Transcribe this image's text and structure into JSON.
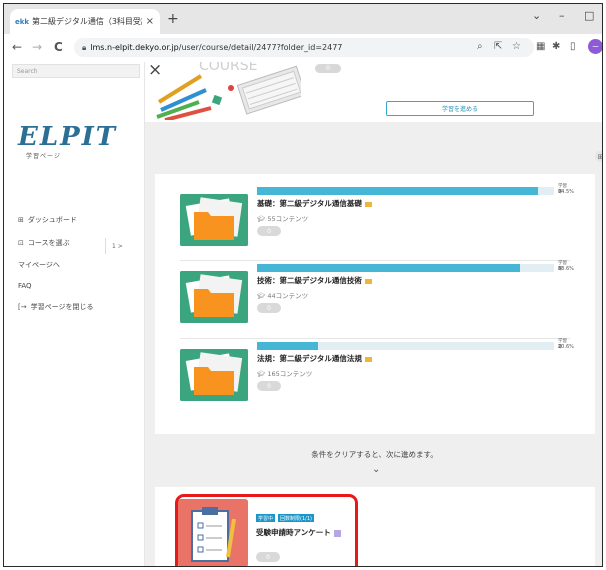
{
  "browser": {
    "tab_favicon": "ekk",
    "tab_title": "第二級デジタル通信（3科目受講",
    "tab_close": "×",
    "new_tab": "+",
    "win_min": "⌄",
    "win_dash": "–",
    "win_max": "□",
    "back": "←",
    "forward": "→",
    "reload": "C",
    "url_domain": "lms.n-elpit.dekyo.or.jp",
    "url_path": "/user/course/detail/2477?folder_id=2477",
    "profile_initial": "ー"
  },
  "sidebar": {
    "search_placeholder": "Search",
    "logo": "ELPIT",
    "logo_sub": "学習ページ",
    "items": [
      {
        "icon": "⊞",
        "label": "ダッシュボード"
      },
      {
        "icon": "⊡",
        "label": "コースを選ぶ"
      },
      {
        "icon": "",
        "label": "マイページへ"
      },
      {
        "icon": "",
        "label": "FAQ"
      },
      {
        "icon": "[→",
        "label": "学習ページを閉じる"
      }
    ],
    "course_pager": "1  >"
  },
  "main": {
    "banner_close": "×",
    "banner_text": "COURSE",
    "top_pill": "0",
    "start_button": "学習を進める",
    "expand_icon": "⊞",
    "courses": [
      {
        "title": "基礎：第二級デジタル通信基礎",
        "count": "55コンテンツ",
        "progress_label": "学習率",
        "progress_text": "94.5%",
        "progress": 0.945,
        "likes": "0"
      },
      {
        "title": "技術：第二級デジタル通信技術",
        "count": "44コンテンツ",
        "progress_label": "学習率",
        "progress_text": "88.6%",
        "progress": 0.886,
        "likes": "0"
      },
      {
        "title": "法規：第二級デジタル通信法規",
        "count": "165コンテンツ",
        "progress_label": "学習率",
        "progress_text": "20.6%",
        "progress": 0.206,
        "likes": "0"
      }
    ],
    "condition_text": "条件をクリアすると、次に進めます。",
    "chevron": "⌄",
    "survey": {
      "badge1": "学習中",
      "badge2": "回数制限(1/1)",
      "title": "受験申請時アンケート",
      "likes": "0"
    }
  },
  "colors": {
    "accent": "#45b6d6",
    "highlight": "#e81919",
    "thumb_green": "#3aa57e",
    "thumb_red": "#e97366",
    "logo": "#2b6f94"
  }
}
